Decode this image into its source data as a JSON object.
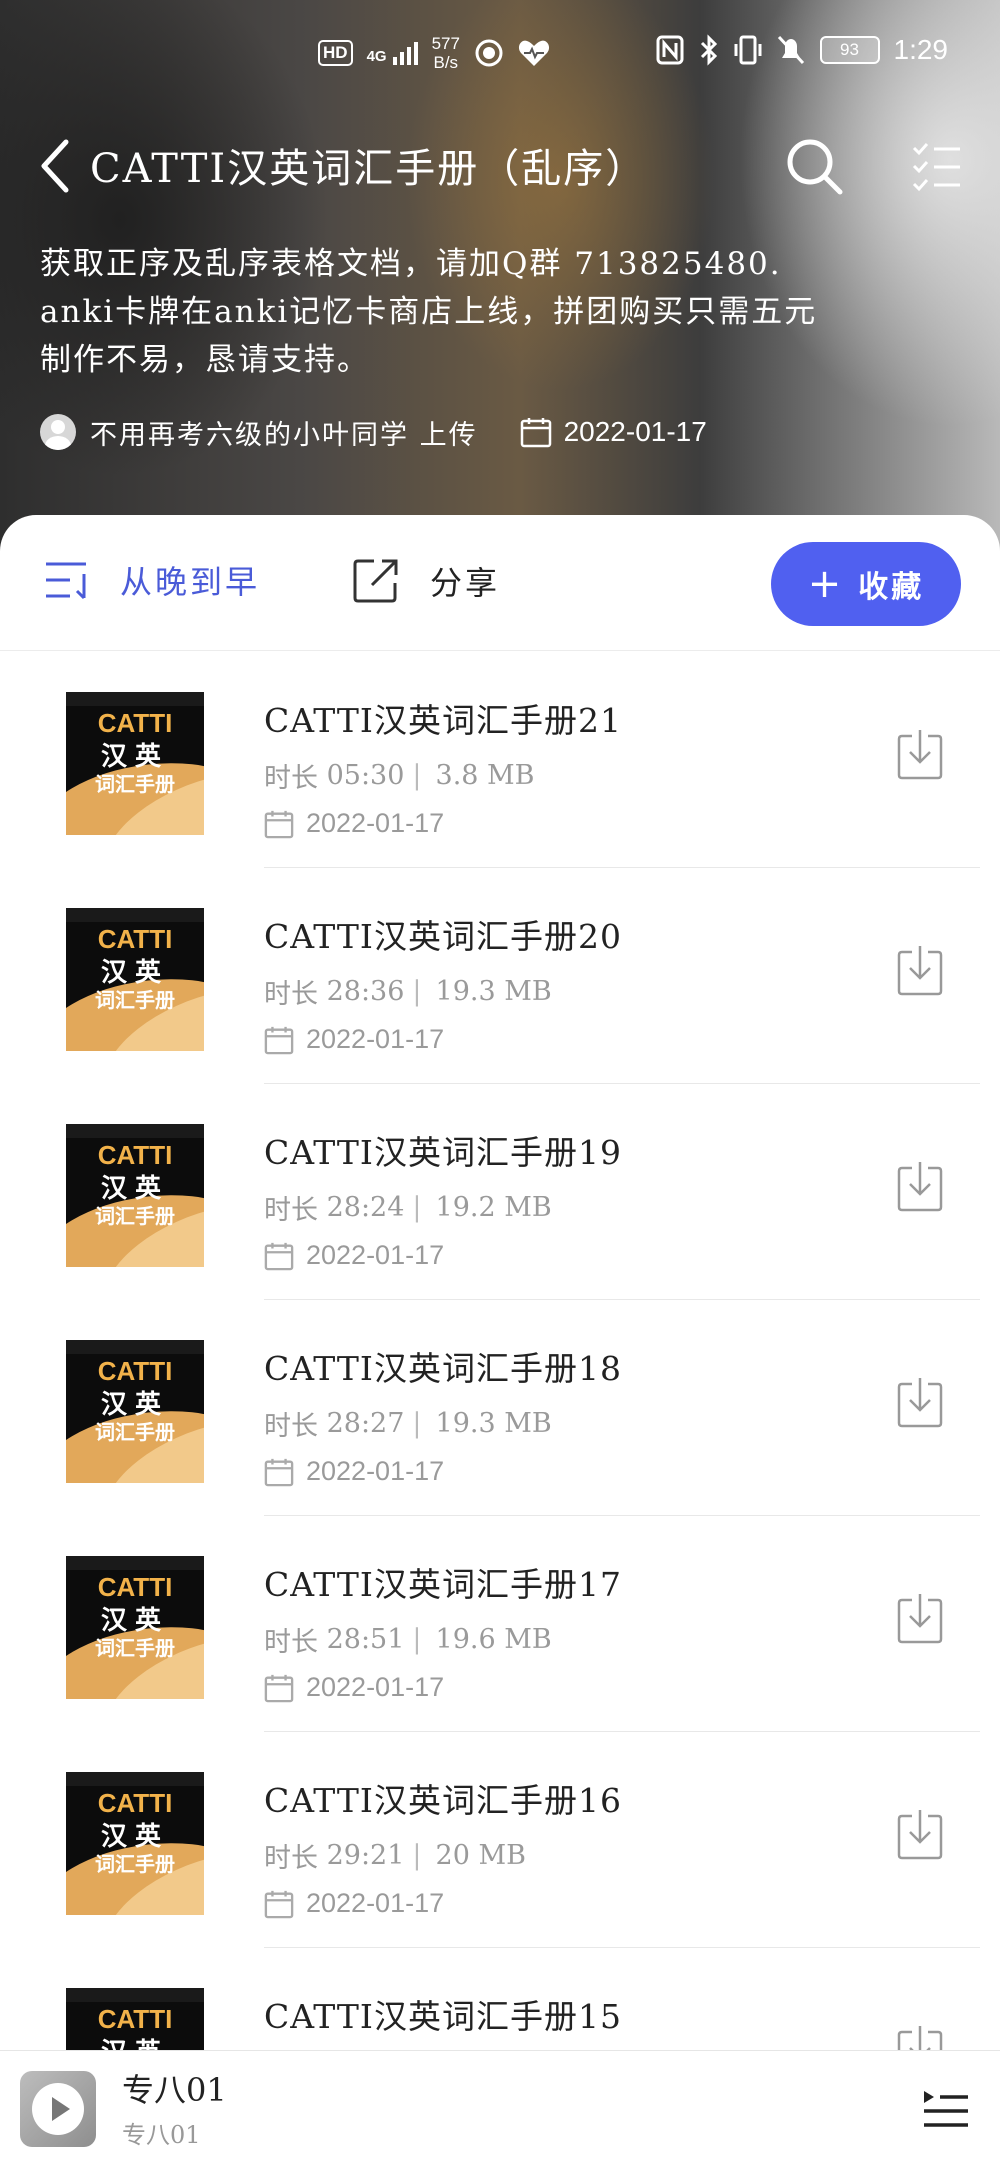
{
  "status_bar": {
    "hd": "HD",
    "signal": "4G",
    "net_speed_value": "577",
    "net_speed_unit": "B/s",
    "battery": "93",
    "time": "1:29"
  },
  "header": {
    "title": "CATTI汉英词汇手册（乱序）",
    "description_lines": [
      "获取正序及乱序表格文档，请加Q群 713825480.",
      "anki卡牌在anki记忆卡商店上线，拼团购买只需五元",
      "制作不易，恳请支持。"
    ],
    "uploader": "不用再考六级的小叶同学 上传",
    "upload_date": "2022-01-17"
  },
  "toolbar": {
    "sort_label": "从晚到早",
    "share_label": "分享",
    "collect_label": "收藏"
  },
  "cover": {
    "line1": "CATTI",
    "line2": "汉英",
    "line3": "词汇手册"
  },
  "tracks": [
    {
      "title": "CATTI汉英词汇手册21",
      "duration_label": "时长",
      "duration": "05:30",
      "size": "3.8 MB",
      "date": "2022-01-17"
    },
    {
      "title": "CATTI汉英词汇手册20",
      "duration_label": "时长",
      "duration": "28:36",
      "size": "19.3 MB",
      "date": "2022-01-17"
    },
    {
      "title": "CATTI汉英词汇手册19",
      "duration_label": "时长",
      "duration": "28:24",
      "size": "19.2 MB",
      "date": "2022-01-17"
    },
    {
      "title": "CATTI汉英词汇手册18",
      "duration_label": "时长",
      "duration": "28:27",
      "size": "19.3 MB",
      "date": "2022-01-17"
    },
    {
      "title": "CATTI汉英词汇手册17",
      "duration_label": "时长",
      "duration": "28:51",
      "size": "19.6 MB",
      "date": "2022-01-17"
    },
    {
      "title": "CATTI汉英词汇手册16",
      "duration_label": "时长",
      "duration": "29:21",
      "size": "20 MB",
      "date": "2022-01-17"
    },
    {
      "title": "CATTI汉英词汇手册15",
      "duration_label": "",
      "duration": "",
      "size": "",
      "date": ""
    }
  ],
  "player": {
    "title": "专八01",
    "subtitle": "专八01"
  },
  "colors": {
    "accent": "#5060f0",
    "sort_text": "#4a5bd8",
    "muted_text": "#9a9a9a"
  },
  "icons": {
    "back": "back-arrow-icon",
    "search": "search-icon",
    "checklist": "checklist-icon",
    "sort": "sort-icon",
    "share": "share-icon",
    "download": "download-icon",
    "calendar": "calendar-icon",
    "play": "play-icon",
    "queue": "queue-icon"
  }
}
